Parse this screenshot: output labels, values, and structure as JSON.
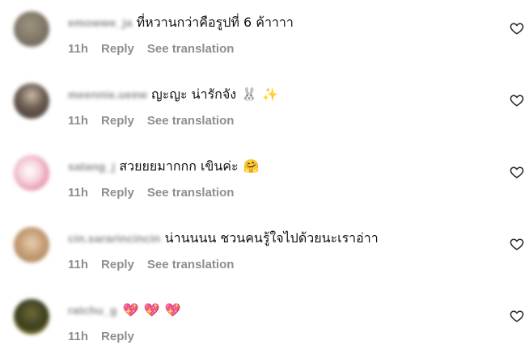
{
  "comments": [
    {
      "username": "emowwe_ja",
      "text": "ที่หวานกว่าคือรูปที่ 6 ค้าาาา",
      "emojis": [],
      "time": "11h",
      "reply_label": "Reply",
      "translate_label": "See translation",
      "avatar_color": "#8a8071"
    },
    {
      "username": "meennie.ueew",
      "text": "ญะญะ น่ารักจัง",
      "emojis": [
        "🐰",
        "✨"
      ],
      "time": "11h",
      "reply_label": "Reply",
      "translate_label": "See translation",
      "avatar_color": "#5b5048"
    },
    {
      "username": "satang_j",
      "text": "สวยยยมากกก เขินค่ะ",
      "emojis": [
        "🤗"
      ],
      "time": "11h",
      "reply_label": "Reply",
      "translate_label": "See translation",
      "avatar_color": "#e9a5b8"
    },
    {
      "username": "cin.sararincincin",
      "text": "น่านนนน ชวนคนรู้ใจไปด้วยนะเราอ่าา",
      "emojis": [],
      "time": "11h",
      "reply_label": "Reply",
      "translate_label": "See translation",
      "avatar_color": "#c7a37c"
    },
    {
      "username": "ratchu_g",
      "text": "",
      "emojis": [
        "💖",
        "💖",
        "💖"
      ],
      "time": "11h",
      "reply_label": "Reply",
      "translate_label": "",
      "avatar_color": "#3a3d1f"
    }
  ],
  "icons": {
    "like": "heart-outline-icon"
  },
  "colors": {
    "meta_text": "#8e8e8e",
    "body_text": "#111111",
    "heart_emoji": "#f0488a"
  }
}
